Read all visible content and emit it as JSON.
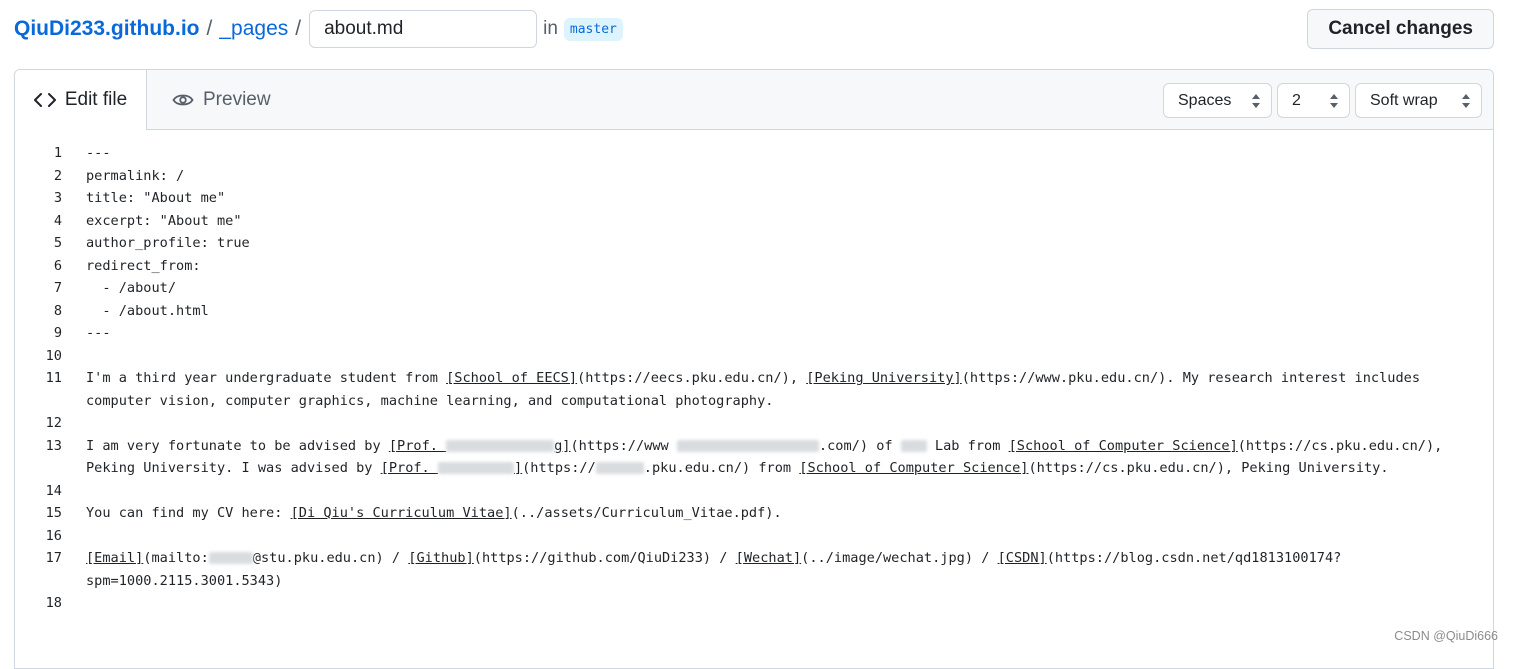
{
  "breadcrumb": {
    "repo": "QiuDi233.github.io",
    "sep1": "/",
    "folder": "_pages",
    "sep2": "/",
    "filename_value": "about.md",
    "in_label": "in",
    "branch": "master"
  },
  "header": {
    "cancel_label": "Cancel changes"
  },
  "tabs": {
    "edit_label": "Edit file",
    "preview_label": "Preview"
  },
  "settings": {
    "indent_mode": "Spaces",
    "indent_size": "2",
    "wrap_mode": "Soft wrap"
  },
  "code": {
    "lines": [
      {
        "n": "1",
        "t": "---"
      },
      {
        "n": "2",
        "t": "permalink: /"
      },
      {
        "n": "3",
        "t": "title: \"About me\""
      },
      {
        "n": "4",
        "t": "excerpt: \"About me\""
      },
      {
        "n": "5",
        "t": "author_profile: true"
      },
      {
        "n": "6",
        "t": "redirect_from:"
      },
      {
        "n": "7",
        "t": "  - /about/"
      },
      {
        "n": "8",
        "t": "  - /about.html"
      },
      {
        "n": "9",
        "t": "---"
      },
      {
        "n": "10",
        "t": ""
      },
      {
        "n": "11"
      },
      {
        "n": "12",
        "t": ""
      },
      {
        "n": "13"
      },
      {
        "n": "14",
        "t": ""
      },
      {
        "n": "15"
      },
      {
        "n": "16",
        "t": ""
      },
      {
        "n": "17"
      },
      {
        "n": "18",
        "t": ""
      }
    ],
    "l11": {
      "a": "I'm a third year undergraduate student from ",
      "link1": "[School of EECS]",
      "b": "(https://eecs.pku.edu.cn/), ",
      "link2": "[Peking University]",
      "c": "(https://www.pku.edu.cn/). My research interest includes computer vision, computer graphics, machine learning, and computational photography."
    },
    "l13": {
      "a": "I am very fortunate to be advised by ",
      "link1a": "[Prof. ",
      "link1b": "g]",
      "b": "(https://www ",
      "c": ".com/) of ",
      "d": " Lab from ",
      "link2": "[School of Computer Science]",
      "e": "(https://cs.pku.edu.cn/), Peking University. I was advised by ",
      "link3a": "[Prof. ",
      "link3b": "]",
      "f": "(https://",
      "g": ".pku.edu.cn/) from ",
      "link4": "[School of Computer Science]",
      "h": "(https://cs.pku.edu.cn/), Peking University."
    },
    "l15": {
      "a": "You can find my CV here: ",
      "link": "[Di Qiu's Curriculum Vitae]",
      "b": "(../assets/Curriculum_Vitae.pdf)."
    },
    "l17": {
      "link1": "[Email]",
      "a": "(mailto:",
      "b": "@stu.pku.edu.cn) / ",
      "link2": "[Github]",
      "c": "(https://github.com/QiuDi233) / ",
      "link3": "[Wechat]",
      "d": "(../image/wechat.jpg) / ",
      "link4": "[CSDN]",
      "e": "(https://blog.csdn.net/qd1813100174?spm=1000.2115.3001.5343)"
    }
  },
  "watermark": "CSDN @QiuDi666"
}
